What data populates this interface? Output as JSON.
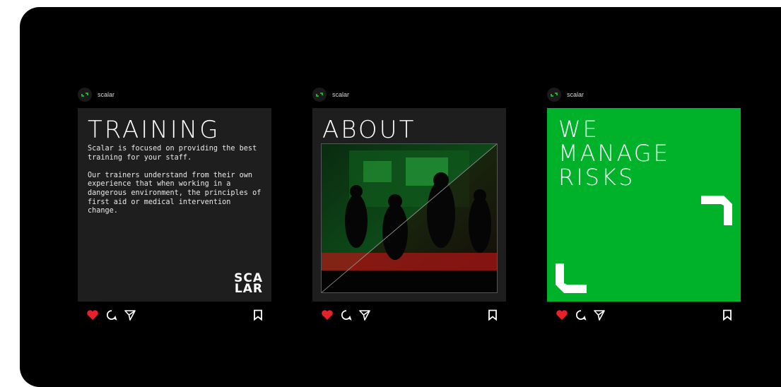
{
  "posts": [
    {
      "username": "scalar",
      "title": "TRAINING",
      "paragraphs": [
        "Scalar is focused on providing the best training for your staff.",
        "Our trainers understand from their own experience that when working in a dangerous environment, the principles of first aid or medical intervention change."
      ],
      "logo_line1": "SCA",
      "logo_line2": "LAR"
    },
    {
      "username": "scalar",
      "title": "ABOUT"
    },
    {
      "username": "scalar",
      "title_lines": [
        "WE",
        "MANAGE",
        "RISKS"
      ]
    }
  ],
  "colors": {
    "background": "#000000",
    "card_dark": "#1e1e1e",
    "brand_green": "#00b22a",
    "like_red": "#e8202a"
  },
  "icons": [
    "heart-icon",
    "comment-icon",
    "share-icon",
    "bookmark-icon",
    "logo-mark-icon"
  ]
}
